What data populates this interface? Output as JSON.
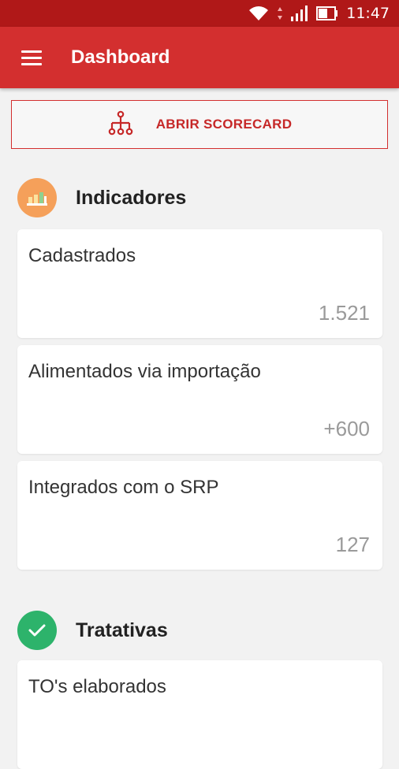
{
  "status_bar": {
    "time": "11:47"
  },
  "app_bar": {
    "title": "Dashboard"
  },
  "scorecard": {
    "label": "ABRIR SCORECARD"
  },
  "sections": {
    "indicadores": {
      "title": "Indicadores",
      "cards": [
        {
          "label": "Cadastrados",
          "value": "1.521"
        },
        {
          "label": "Alimentados via importação",
          "value": "+600"
        },
        {
          "label": "Integrados com o SRP",
          "value": "127"
        }
      ]
    },
    "tratativas": {
      "title": "Tratativas",
      "cards": [
        {
          "label": "TO's elaborados"
        }
      ]
    }
  },
  "colors": {
    "primary": "#d32f2f",
    "status_bar": "#b01818",
    "indicadores_icon": "#f5a05a",
    "tratativas_icon": "#2db36b",
    "background": "#f2f2f2"
  },
  "icons": {
    "menu": "menu-icon",
    "scorecard": "hierarchy-icon",
    "indicadores": "bar-chart-icon",
    "tratativas": "check-icon",
    "wifi": "wifi-icon",
    "signal": "signal-icon",
    "battery": "battery-icon"
  }
}
